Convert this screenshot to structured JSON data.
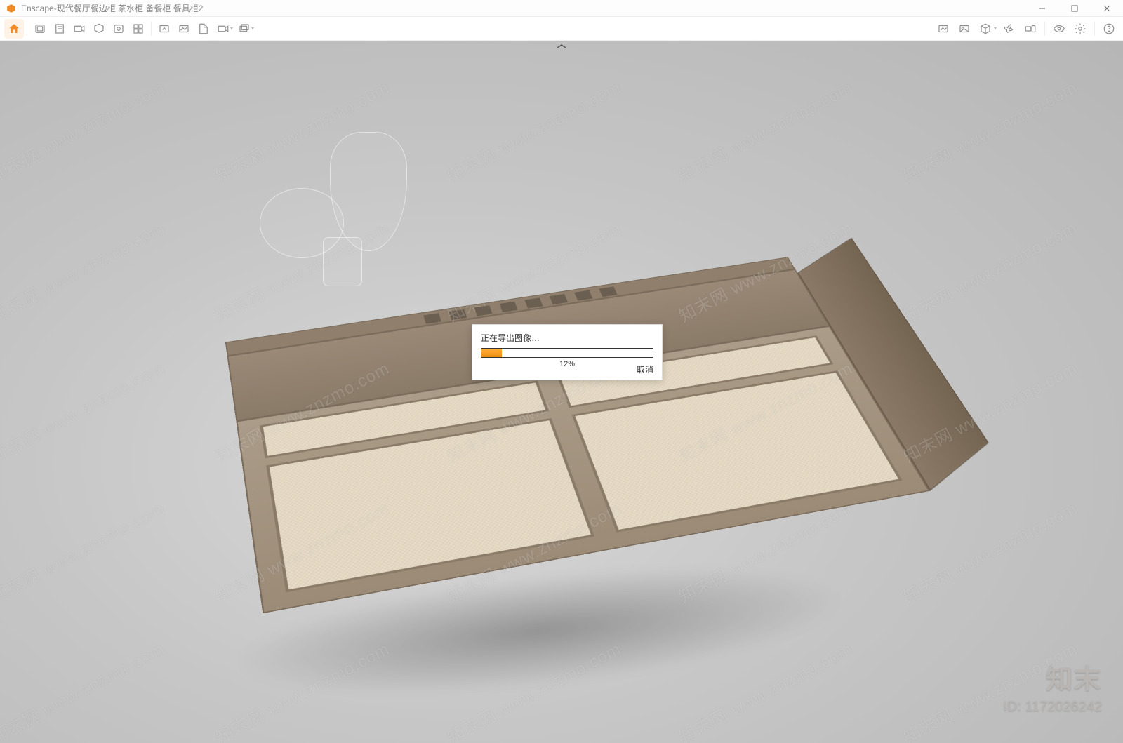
{
  "app": {
    "name": "Enscape",
    "document_title": "现代餐厅餐边柜 茶水柜 备餐柜 餐具柜2",
    "title_separator": " - "
  },
  "window_controls": {
    "minimize": "—",
    "maximize": "□",
    "close": "✕"
  },
  "toolbar_left_icons": [
    "home-icon",
    "screenshot-icon",
    "favorites-icon",
    "video-icon",
    "vr-icon",
    "panorama-icon",
    "collab-icon",
    "upload-icon",
    "mono-icon",
    "image-icon",
    "qr-icon",
    "batch-icon",
    "layers-icon"
  ],
  "toolbar_right_icons": [
    "materials-icon",
    "assets-icon",
    "cube-icon",
    "lighting-icon",
    "sync-icon",
    "eye-icon",
    "settings-icon",
    "help-icon"
  ],
  "viewport": {
    "scene_description": "现代餐厅餐边柜 — wood sideboard with rattan panels, glass carafe and cups on top"
  },
  "dialog": {
    "title": "正在导出图像…",
    "percent_text": "12%",
    "percent_value": 12,
    "cancel": "取消"
  },
  "watermark": {
    "text": "知末网 www.znzmo.com",
    "brand": "知末",
    "id_label": "ID: 1172026242"
  }
}
